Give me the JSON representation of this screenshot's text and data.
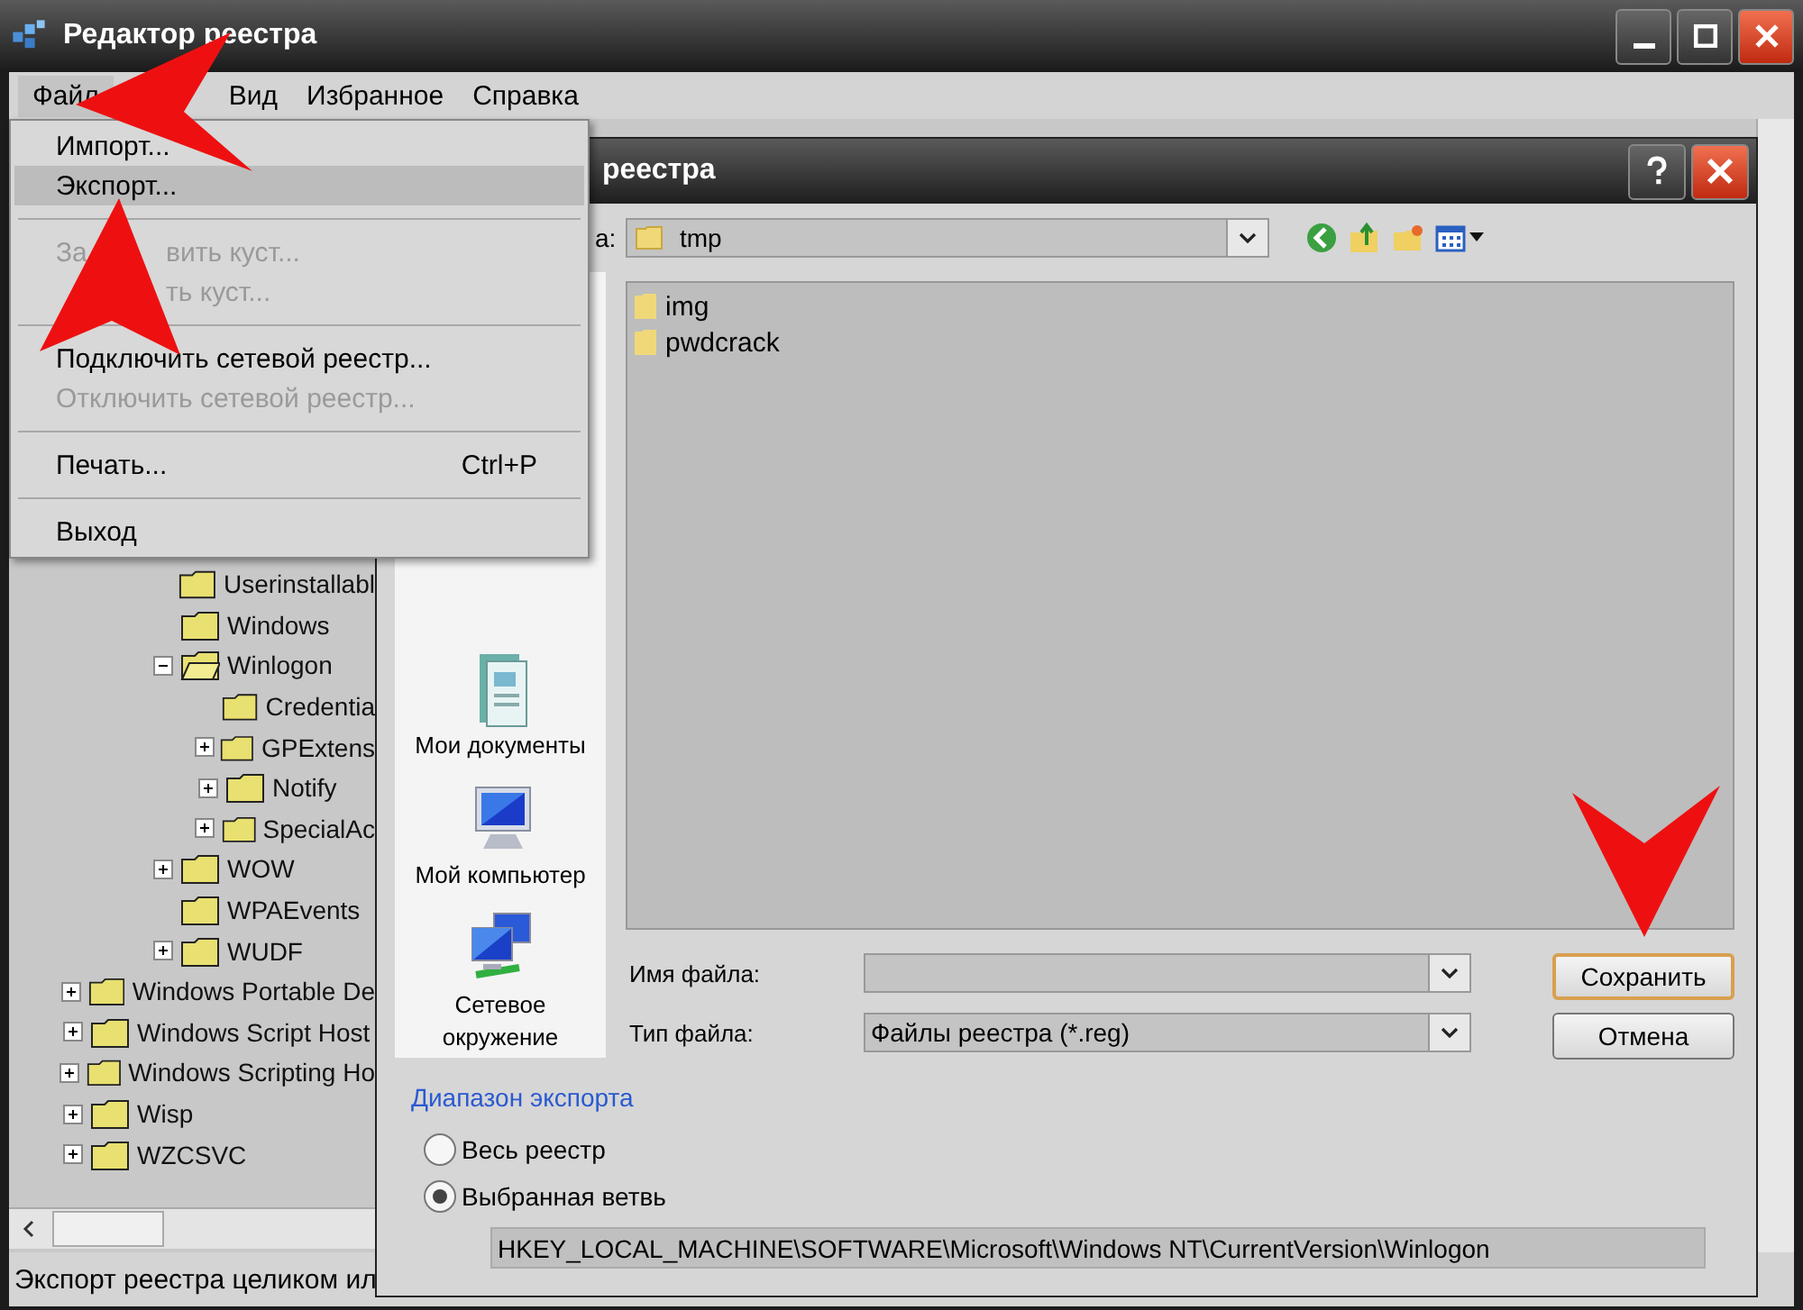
{
  "window": {
    "title": "Редактор реестра"
  },
  "menu_bar": [
    {
      "label": "Файл",
      "selected": true
    },
    {
      "label": "Вид",
      "selected": false
    },
    {
      "label": "Избранное",
      "selected": false
    },
    {
      "label": "Справка",
      "selected": false
    }
  ],
  "file_menu": [
    {
      "kind": "item",
      "label": "Импорт...",
      "disabled": false,
      "selected": false
    },
    {
      "kind": "item",
      "label": "Экспорт...",
      "disabled": false,
      "selected": true
    },
    {
      "kind": "separator"
    },
    {
      "kind": "item",
      "before": "За",
      "after": "вить куст...",
      "disabled": true,
      "selected": false
    },
    {
      "kind": "item",
      "after": "ть куст...",
      "disabled": true,
      "selected": false
    },
    {
      "kind": "separator"
    },
    {
      "kind": "item",
      "label": "Подключить сетевой реестр...",
      "disabled": false,
      "selected": false
    },
    {
      "kind": "item",
      "label": "Отключить сетевой реестр...",
      "disabled": true,
      "selected": false
    },
    {
      "kind": "separator"
    },
    {
      "kind": "item",
      "label": "Печать...",
      "shortcut": "Ctrl+P",
      "disabled": false,
      "selected": false
    },
    {
      "kind": "separator"
    },
    {
      "kind": "item",
      "label": "Выход",
      "disabled": false,
      "selected": false
    }
  ],
  "tree": [
    {
      "children": [
        {
          "children": [
            {
              "label": "Userinstallabl"
            },
            {
              "label": "Windows"
            },
            {
              "label": "Winlogon",
              "expanded": true,
              "children": [
                {
                  "label": "Credentia"
                },
                {
                  "label": "GPExtens",
                  "expanded": false
                },
                {
                  "label": "Notify",
                  "expanded": false
                },
                {
                  "label": "SpecialAc",
                  "expanded": false
                }
              ]
            },
            {
              "label": "WOW",
              "expanded": false
            },
            {
              "label": "WPAEvents"
            },
            {
              "label": "WUDF",
              "expanded": false
            }
          ]
        }
      ]
    },
    {
      "label": "Windows Portable De",
      "expanded": false
    },
    {
      "label": "Windows Script Host",
      "expanded": false
    },
    {
      "label": "Windows Scripting Ho",
      "expanded": false
    },
    {
      "label": "Wisp",
      "expanded": false
    },
    {
      "label": "WZCSVC",
      "expanded": false
    }
  ],
  "status_bar": "Экспорт реестра целиком ил",
  "dialog": {
    "title": "реестра",
    "folder_label": "а:",
    "folder": "tmp",
    "places": [
      {
        "kind": "documents",
        "label": "Мои документы"
      },
      {
        "kind": "computer",
        "label": "Мой компьютер"
      },
      {
        "kind": "network",
        "label": "Сетевое окружение"
      }
    ],
    "files": [
      "img",
      "pwdcrack"
    ],
    "filename_label": "Имя файла:",
    "filetype_label": "Тип файла:",
    "filetype": "Файлы реестра (*.reg)",
    "buttons": [
      {
        "label": "Сохранить",
        "default": true
      },
      {
        "label": "Отмена",
        "default": false
      }
    ],
    "range_heading": "Диапазон экспорта",
    "range_options": [
      {
        "label": "Весь реестр",
        "selected": false
      },
      {
        "label": "Выбранная ветвь",
        "selected": true
      }
    ],
    "branch": "HKEY_LOCAL_MACHINE\\SOFTWARE\\Microsoft\\Windows NT\\CurrentVersion\\Winlogon"
  }
}
